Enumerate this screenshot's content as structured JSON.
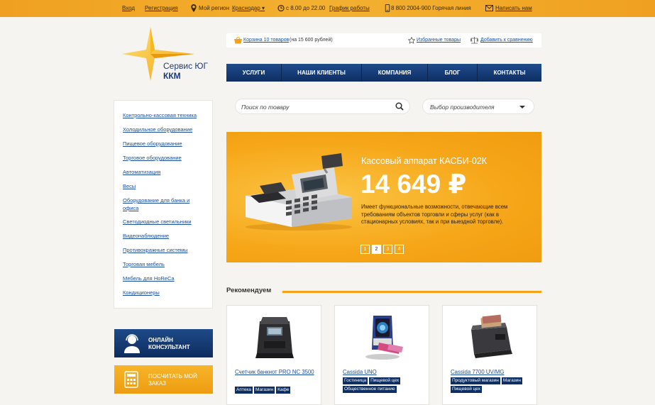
{
  "topbar": {
    "login": "Вход",
    "register": "Регистрация",
    "region_label": "Мой регион",
    "region_value": "Краснодар",
    "hours": "с 8.00 до 22.00",
    "schedule": "График работы",
    "hotline": "8 800 2004-900 Горячая линия",
    "write_us": "Написать нам"
  },
  "logo": {
    "line1": "Сервис ЮГ",
    "line2": "ККМ"
  },
  "cart": {
    "cart_link": "Корзина 10 товаров",
    "cart_sum": "(на 15 600 рублей)",
    "favorites": "Избранные товары",
    "compare": "Добавить к сравнению"
  },
  "nav": [
    "УСЛУГИ",
    "НАШИ КЛИЕНТЫ",
    "КОМПАНИЯ",
    "БЛОГ",
    "КОНТАКТЫ"
  ],
  "search": {
    "placeholder": "Поиск по товару",
    "manufacturer": "Выбор производителя"
  },
  "sidebar": [
    "Контрольно-кассовая техника",
    "Холодильное оборудование",
    "Пищевое оборудование",
    "Торговое оборудование",
    "Автоматизация",
    "Весы",
    "Оборудование для банка и офиса",
    "Светодиодные светильники",
    "Видеонаблюдение",
    "Противокражные системы",
    "Торговая мебель",
    "Мебель для HoReCa",
    "Кондиционеры"
  ],
  "side_buttons": {
    "consultant": "ОНЛАЙН КОНСУЛЬТАНТ",
    "calc": "ПОСЧИТАТЬ МОЙ ЗАКАЗ"
  },
  "banner": {
    "title": "Кассовый аппарат КАСБИ-02К",
    "price": "14 649 ₽",
    "description": "Имеет функциональные возможности, отвечающие всем требованиям объектов торговли и сферы услуг (как в стационарных условиях, так и при выездной торговле).",
    "pages": [
      "1",
      "2",
      "3",
      "4"
    ],
    "active_page": "2"
  },
  "recommended": {
    "title": "Рекомендуем",
    "products": [
      {
        "name": "Счетчик банкнот PRO NC 3500",
        "tags": [
          "Аптека",
          "Магазин",
          "Кафе"
        ]
      },
      {
        "name": "Cassida UNO",
        "tags": [
          "Гостиница",
          "Пищевой цех",
          "Общественное питание"
        ]
      },
      {
        "name": "Cassida 7700 UV/MG",
        "tags": [
          "Продуктовый магазин",
          "Магазин",
          "Пищевой цех"
        ]
      }
    ]
  },
  "colors": {
    "accent": "#f3a21a",
    "nav": "#123a74",
    "link": "#1b4f9c"
  }
}
